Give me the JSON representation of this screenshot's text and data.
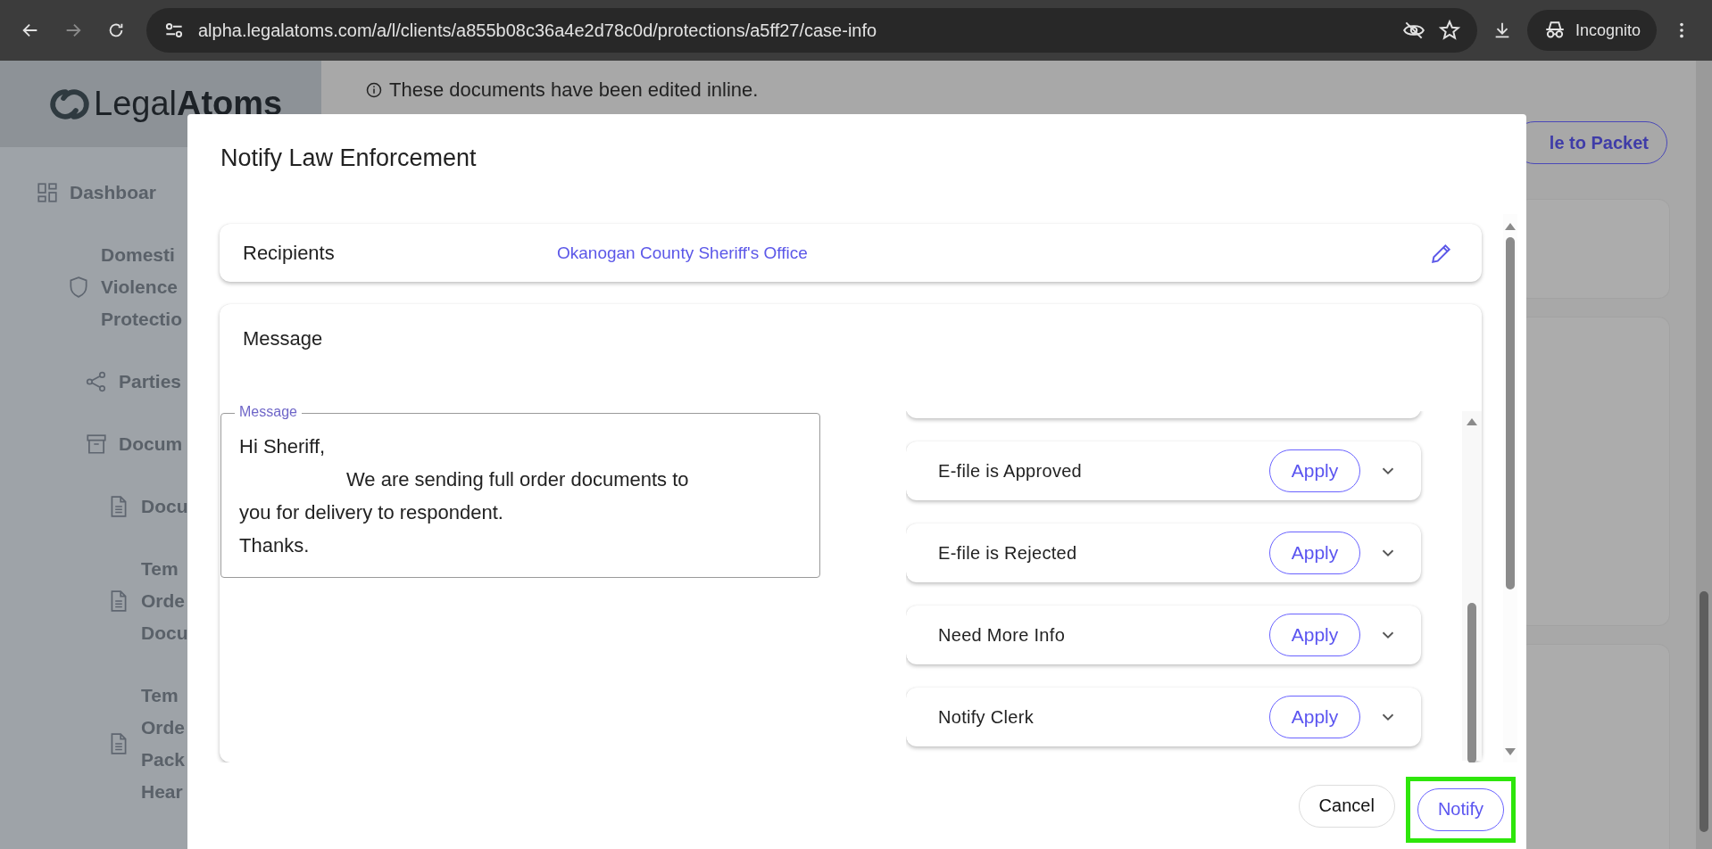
{
  "browser": {
    "url": "alpha.legalatoms.com/a/l/clients/a855b08c36a4e2d78c0d/protections/a5ff27/case-info",
    "profile": "Incognito"
  },
  "sidebar": {
    "logo": {
      "light": "Legal",
      "bold": "Atoms"
    },
    "items": [
      {
        "kind": "grid",
        "lines": [
          "Dashboar"
        ]
      },
      {
        "kind": "shield",
        "lines": [
          "Domesti",
          "Violence",
          "Protectio"
        ],
        "children": [
          {
            "kind": "share",
            "lines": [
              "Parties"
            ]
          },
          {
            "kind": "archive",
            "lines": [
              "Docum"
            ],
            "children": [
              {
                "kind": "file",
                "lines": [
                  "Docu"
                ]
              },
              {
                "kind": "file",
                "lines": [
                  "Tem",
                  "Orde",
                  "Docu"
                ]
              },
              {
                "kind": "file",
                "lines": [
                  "Tem",
                  "Orde",
                  "Pack",
                  "Hear"
                ]
              }
            ]
          }
        ]
      }
    ]
  },
  "main": {
    "notice": "These documents have been edited inline.",
    "packet_button": "le to Packet"
  },
  "dialog": {
    "title": "Notify Law Enforcement",
    "recipients": {
      "label": "Recipients",
      "value": "Okanogan County Sheriff's Office"
    },
    "message": {
      "heading": "Message",
      "field_label": "Message",
      "value": "Hi Sheriff,\n\t\tWe are sending full order documents to you for delivery to respondent.\nThanks."
    },
    "templates": [
      {
        "label": "E-file is Approved",
        "action": "Apply",
        "expanded": false
      },
      {
        "label": "E-file is Rejected",
        "action": "Apply",
        "expanded": false
      },
      {
        "label": "Need More Info",
        "action": "Apply",
        "expanded": false
      },
      {
        "label": "Notify Clerk",
        "action": "Apply",
        "expanded": false
      }
    ],
    "actions": [
      {
        "label": "Cancel",
        "kind": "plain",
        "highlighted": false
      },
      {
        "label": "Notify",
        "kind": "outlined",
        "highlighted": true
      }
    ]
  }
}
